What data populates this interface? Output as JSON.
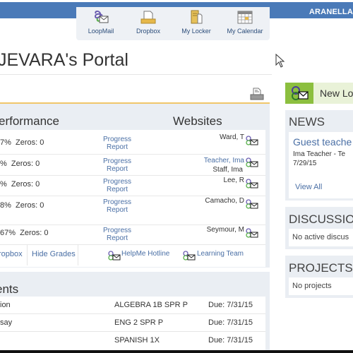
{
  "header": {
    "user_name": "ARANELLA"
  },
  "quicknav": [
    {
      "label": "LoopMail",
      "icon": "loopmail-icon"
    },
    {
      "label": "Dropbox",
      "icon": "dropbox-icon"
    },
    {
      "label": "My Locker",
      "icon": "locker-icon"
    },
    {
      "label": "My Calendar",
      "icon": "calendar-icon"
    }
  ],
  "page": {
    "title": "JEVARA's Portal"
  },
  "performance": {
    "heading": "erformance",
    "websites_heading": "Websites",
    "rows": [
      {
        "grade": "7%",
        "zeros": "Zeros: 0",
        "report": [
          "Progress",
          "Report"
        ],
        "teacher": "Ward, T",
        "teacher_link": false,
        "extra": ""
      },
      {
        "grade": "%",
        "zeros": "Zeros: 0",
        "report": [
          "Progress",
          "Report"
        ],
        "teacher": "Teacher, Ima",
        "teacher_link": true,
        "extra": "Staff, Ima"
      },
      {
        "grade": "%",
        "zeros": "Zeros: 0",
        "report": [
          "Progress",
          "Report"
        ],
        "teacher": "Lee, R",
        "teacher_link": false,
        "extra": ""
      },
      {
        "grade": "8%",
        "zeros": "Zeros: 0",
        "report": [
          "Progress",
          "Report"
        ],
        "teacher": "Camacho, D",
        "teacher_link": false,
        "extra": ""
      },
      {
        "grade": "67%",
        "zeros": "Zeros: 0",
        "report": [
          "Progress",
          "Report"
        ],
        "teacher": "Seymour, M",
        "teacher_link": false,
        "extra": ""
      }
    ],
    "links": {
      "dropbox": "ropbox",
      "hide_grades": "Hide Grades",
      "helpme": "HelpMe Hotline",
      "learning": "Learning Team"
    }
  },
  "assignments": {
    "heading": "ents",
    "rows": [
      {
        "name": "ion",
        "course": "ALGEBRA 1B SPR P",
        "due": "Due: 7/31/15"
      },
      {
        "name": "say",
        "course": "ENG 2 SPR P",
        "due": "Due: 7/31/15"
      },
      {
        "name": "",
        "course": "SPANISH 1X",
        "due": "Due: 7/31/15"
      }
    ]
  },
  "sidebar": {
    "new_loopmail": "New Lo",
    "news": {
      "heading": "NEWS",
      "item_title": "Guest teache",
      "item_author": "Ima Teacher - Te",
      "item_date": "7/29/15",
      "view_all": "View All"
    },
    "discussions": {
      "heading": "DISCUSSIO",
      "empty": "No active discus"
    },
    "projects": {
      "heading": "PROJECTS",
      "empty": "No projects"
    }
  },
  "colors": {
    "topbar": "#4a7ab8",
    "link": "#4a6fa5",
    "accent_gold": "#f0c66a",
    "loopmail_green": "#8cbf3f"
  }
}
